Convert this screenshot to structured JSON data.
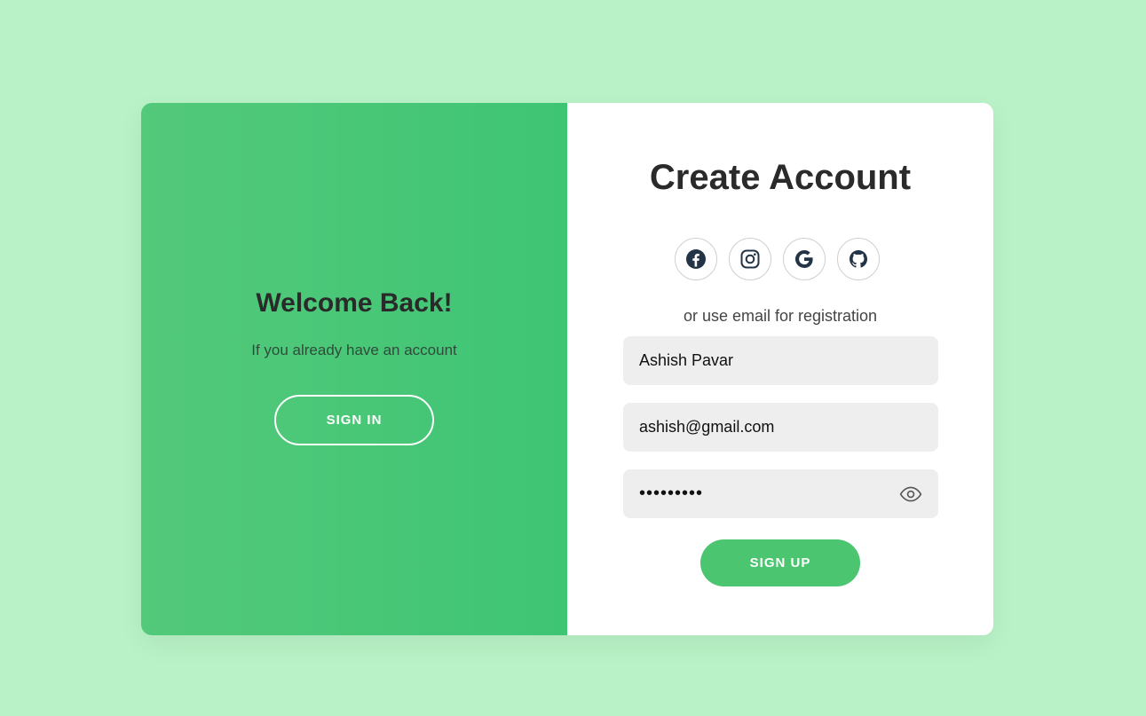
{
  "colors": {
    "background": "#b9f2c6",
    "accent": "#4cc571",
    "left_panel_start": "#53c97a",
    "left_panel_end": "#3ec574"
  },
  "left": {
    "title": "Welcome Back!",
    "text": "If you already have an account",
    "signin_label": "SIGN IN"
  },
  "right": {
    "title": "Create Account",
    "social": [
      {
        "icon": "facebook-icon"
      },
      {
        "icon": "instagram-icon"
      },
      {
        "icon": "google-icon"
      },
      {
        "icon": "github-icon"
      }
    ],
    "or_text": "or use email for registration",
    "name_value": "Ashish Pavar",
    "email_value": "ashish@gmail.com",
    "password_value": "•••••••••",
    "signup_label": "SIGN UP"
  }
}
